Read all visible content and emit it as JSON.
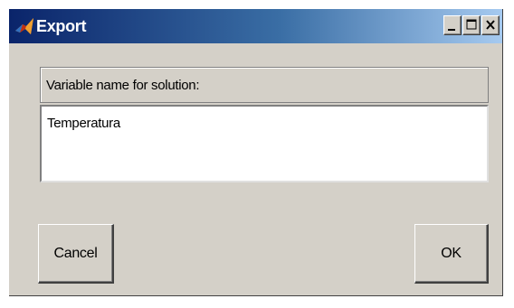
{
  "window": {
    "title": "Export",
    "icon": "matlab-icon"
  },
  "titlebar_buttons": {
    "minimize_icon": "minimize-icon",
    "maximize_icon": "maximize-icon",
    "close_icon": "close-icon"
  },
  "form": {
    "label": "Variable name for solution:",
    "value": "Temperatura"
  },
  "buttons": {
    "cancel_label": "Cancel",
    "ok_label": "OK"
  },
  "colors": {
    "title_start": "#0a246a",
    "title_end": "#a6caf0",
    "dialog_face": "#d4d0c8"
  }
}
